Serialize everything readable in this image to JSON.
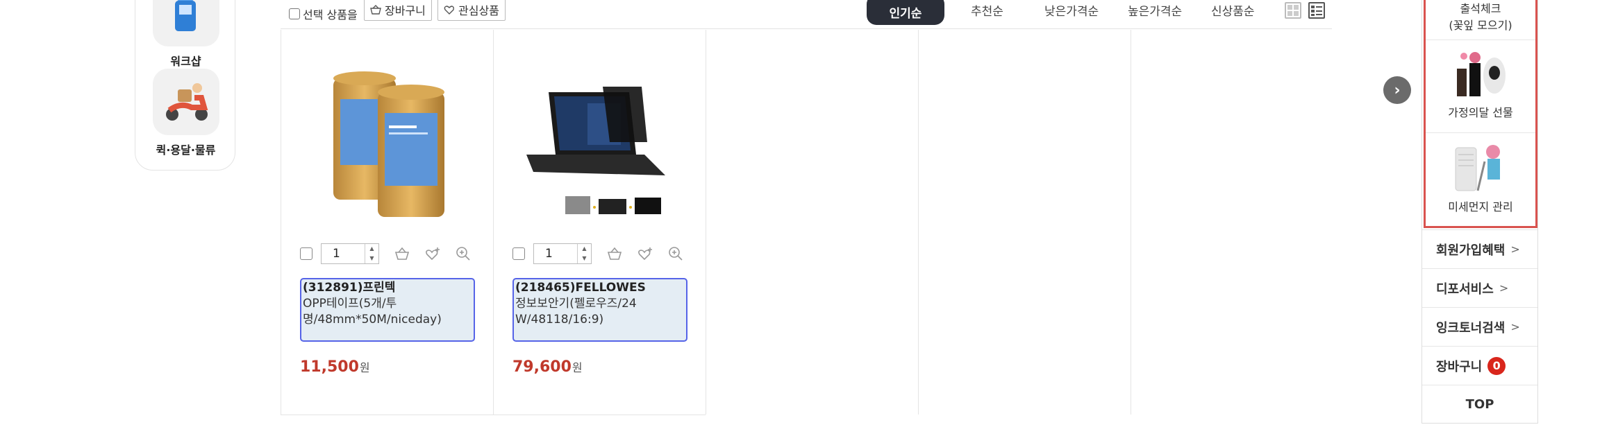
{
  "left_panel": {
    "categories": [
      {
        "label": "워크샵",
        "icon": "workshop-icon"
      },
      {
        "label": "퀵·용달·물류",
        "icon": "scooter-icon"
      }
    ]
  },
  "toolbar": {
    "select_label": "선택 상품을",
    "cart_button": "장바구니",
    "wish_button": "관심상품",
    "sort_options": [
      "인기순",
      "추천순",
      "낮은가격순",
      "높은가격순",
      "신상품순"
    ],
    "active_sort": "인기순"
  },
  "products": [
    {
      "code": "(312891)프린텍",
      "name": "OPP테이프(5개/투명/48mm*50M/niceday)",
      "name_lines": [
        "OPP테이프(5개/투",
        "명/48mm*50M/niceday)"
      ],
      "quantity": "1",
      "price": "11,500",
      "currency": "원",
      "image": "tape-rolls-image"
    },
    {
      "code": "(218465)FELLOWES",
      "name": "정보보안기(펠로우즈/24W/48118/16:9)",
      "name_lines": [
        "정보보안기(펠로우즈/24",
        "W/48118/16:9)"
      ],
      "quantity": "1",
      "price": "79,600",
      "currency": "원",
      "image": "laptop-privacy-filter-image"
    }
  ],
  "quick_menu": {
    "attendance": [
      "출석체크",
      "(꽃잎 모으기)"
    ],
    "gift": "가정의달 선물",
    "dust": "미세먼지 관리",
    "links": [
      {
        "label": "회원가입혜택",
        "chevron": ">"
      },
      {
        "label": "디포서비스",
        "chevron": ">"
      },
      {
        "label": "잉크토너검색",
        "chevron": ">"
      }
    ],
    "cart_label": "장바구니",
    "cart_count": "0",
    "top_label": "TOP"
  },
  "colors": {
    "accent_red": "#c0392b",
    "name_box_border": "#5563e8",
    "name_box_bg": "#e4edf4",
    "sort_active_bg": "#2a2e38",
    "badge": "#d9261c"
  }
}
